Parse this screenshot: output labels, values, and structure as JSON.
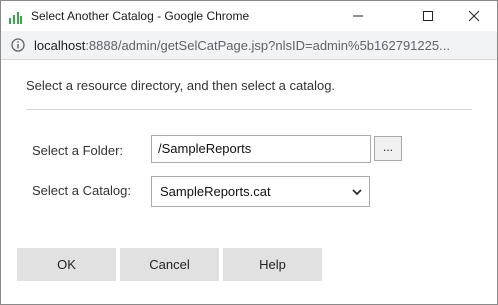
{
  "window": {
    "title": "Select Another Catalog - Google Chrome",
    "controls": [
      "minimize",
      "maximize",
      "close"
    ]
  },
  "addressbar": {
    "host": "localhost",
    "path": ":8888/admin/getSelCatPage.jsp?nlsID=admin%5b162791225..."
  },
  "form": {
    "instruction": "Select a resource directory, and then select a catalog.",
    "folder_label": "Select a Folder:",
    "folder_value": "/SampleReports",
    "browse_label": "...",
    "catalog_label": "Select a Catalog:",
    "catalog_value": "SampleReports.cat"
  },
  "buttons": {
    "ok": "OK",
    "cancel": "Cancel",
    "help": "Help"
  }
}
